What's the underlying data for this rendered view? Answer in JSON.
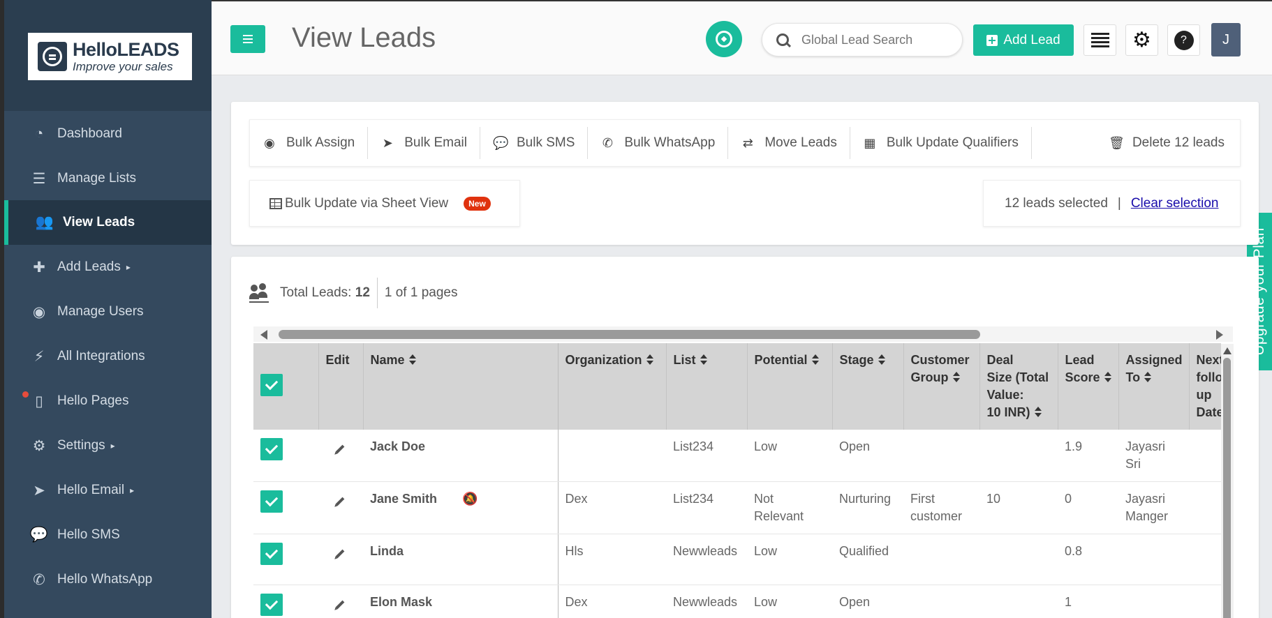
{
  "sidebar": {
    "logo": {
      "word_part1": "Hello",
      "word_part2": "LEADS",
      "tagline": "Improve your sales"
    },
    "items": [
      {
        "label": "Dashboard",
        "icon": "dashboard-icon",
        "active": false
      },
      {
        "label": "Manage Lists",
        "icon": "list-icon",
        "active": false
      },
      {
        "label": "View Leads",
        "icon": "users-icon",
        "active": true
      },
      {
        "label": "Add Leads",
        "icon": "add-user-icon",
        "active": false,
        "caret": true
      },
      {
        "label": "Manage Users",
        "icon": "user-circle-icon",
        "active": false
      },
      {
        "label": "All Integrations",
        "icon": "plug-icon",
        "active": false
      },
      {
        "label": "Hello Pages",
        "icon": "file-code-icon",
        "active": false,
        "dot": true
      },
      {
        "label": "Settings",
        "icon": "gear-icon",
        "active": false,
        "caret": true
      },
      {
        "label": "Hello Email",
        "icon": "paper-plane-icon",
        "active": false,
        "caret": true
      },
      {
        "label": "Hello SMS",
        "icon": "chat-icon",
        "active": false
      },
      {
        "label": "Hello WhatsApp",
        "icon": "whatsapp-icon",
        "active": false
      }
    ]
  },
  "header": {
    "title": "View Leads",
    "search_placeholder": "Global Lead Search",
    "add_lead_label": "Add Lead",
    "avatar_initial": "J"
  },
  "upgrade_label": "Upgrade your Plan",
  "bulk_actions": {
    "items": [
      {
        "label": "Bulk Assign",
        "icon": "user-circle-icon"
      },
      {
        "label": "Bulk Email",
        "icon": "paper-plane-icon"
      },
      {
        "label": "Bulk SMS",
        "icon": "chat-icon"
      },
      {
        "label": "Bulk WhatsApp",
        "icon": "whatsapp-icon"
      },
      {
        "label": "Move Leads",
        "icon": "exchange-icon"
      },
      {
        "label": "Bulk Update Qualifiers",
        "icon": "grid-icon"
      }
    ],
    "delete_label": "Delete 12 leads",
    "sheet_view_label": "Bulk Update via Sheet View",
    "new_badge": "New",
    "selected_text": "12 leads selected",
    "selection_separator": "|",
    "clear_label": "Clear selection"
  },
  "table": {
    "total_label": "Total Leads:",
    "total_value": "12",
    "pages_text": "1 of 1 pages",
    "columns": {
      "edit": "Edit",
      "name": "Name",
      "organization": "Organization",
      "list": "List",
      "potential": "Potential",
      "stage": "Stage",
      "customer_group_1": "Customer",
      "customer_group_2": "Group",
      "deal_1": "Deal",
      "deal_2": "Size (Total",
      "deal_3": "Value:",
      "deal_4": "10 INR)",
      "score_1": "Lead",
      "score_2": "Score",
      "assigned_1": "Assigned",
      "assigned_2": "To",
      "next_1": "Next",
      "next_2": "follo",
      "next_3": "up",
      "next_4": "Date"
    },
    "rows": [
      {
        "name": "Jack Doe",
        "organization": "",
        "list": "List234",
        "potential": "Low",
        "stage": "Open",
        "customer_group": "",
        "deal_size": "",
        "lead_score": "1.9",
        "assigned_to": "Jayasri Sri",
        "muted": false
      },
      {
        "name": "Jane Smith",
        "organization": "Dex",
        "list": "List234",
        "potential": "Not Relevant",
        "stage": "Nurturing",
        "customer_group": "First customer",
        "deal_size": "10",
        "lead_score": "0",
        "assigned_to": "Jayasri Manger",
        "muted": true
      },
      {
        "name": "Linda",
        "organization": "Hls",
        "list": "Newwleads",
        "potential": "Low",
        "stage": "Qualified",
        "customer_group": "",
        "deal_size": "",
        "lead_score": "0.8",
        "assigned_to": "",
        "muted": false
      },
      {
        "name": "Elon Mask",
        "organization": "Dex",
        "list": "Newwleads",
        "potential": "Low",
        "stage": "Open",
        "customer_group": "",
        "deal_size": "",
        "lead_score": "1",
        "assigned_to": "",
        "muted": false
      }
    ]
  },
  "colors": {
    "accent": "#1abc9c",
    "sidebar": "#34495e",
    "sidebar_active": "#243646",
    "badge_red": "#e0320e",
    "link": "#1a0dab"
  }
}
